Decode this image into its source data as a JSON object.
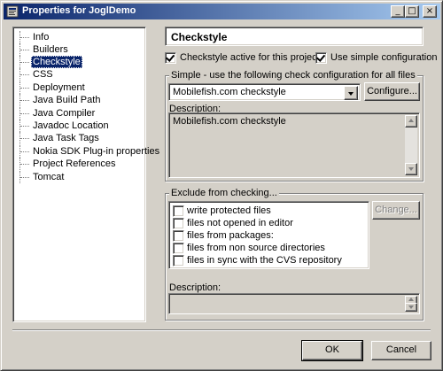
{
  "window": {
    "title": "Properties for JoglDemo",
    "controls": {
      "minimize": "_",
      "maximize": "□",
      "close": "×"
    }
  },
  "nav": {
    "items": [
      {
        "label": "Info"
      },
      {
        "label": "Builders"
      },
      {
        "label": "Checkstyle",
        "selected": true
      },
      {
        "label": "CSS"
      },
      {
        "label": "Deployment"
      },
      {
        "label": "Java Build Path"
      },
      {
        "label": "Java Compiler"
      },
      {
        "label": "Javadoc Location"
      },
      {
        "label": "Java Task Tags"
      },
      {
        "label": "Nokia SDK Plug-in properties"
      },
      {
        "label": "Project References"
      },
      {
        "label": "Tomcat"
      }
    ]
  },
  "page": {
    "title": "Checkstyle",
    "active_checkbox": {
      "label": "Checkstyle active for this project",
      "checked": true
    },
    "simple_checkbox": {
      "label": "Use simple configuration",
      "checked": true
    },
    "simple_group": {
      "title": "Simple - use the following check configuration for all files",
      "config_select": {
        "value": "Mobilefish.com checkstyle"
      },
      "configure_button": "Configure...",
      "description_label": "Description:",
      "description_text": "Mobilefish.com checkstyle"
    },
    "exclude_group": {
      "title": "Exclude from checking...",
      "items": [
        {
          "label": "write protected files",
          "checked": false
        },
        {
          "label": "files not opened in editor",
          "checked": false
        },
        {
          "label": "files from packages:",
          "checked": false
        },
        {
          "label": "files from non source directories",
          "checked": false
        },
        {
          "label": "files in sync with the CVS repository",
          "checked": false
        }
      ],
      "change_button": "Change...",
      "description_label": "Description:",
      "description_text": ""
    }
  },
  "footer": {
    "ok_button": "OK",
    "cancel_button": "Cancel"
  },
  "colors": {
    "titlebar_start": "#0a246a",
    "titlebar_end": "#a6caf0",
    "selection": "#0a246a",
    "face": "#d4d0c8"
  }
}
